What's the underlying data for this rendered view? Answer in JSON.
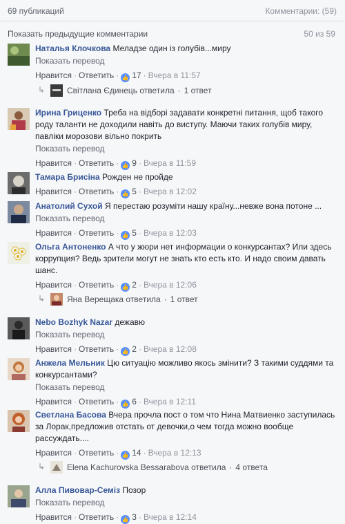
{
  "header": {
    "publications": "69 публикаций",
    "comments_total": "Комментарии: (59)"
  },
  "pager": {
    "previous_label": "Показать предыдущие комментарии",
    "count": "50 из 59"
  },
  "labels": {
    "translate": "Показать перевод",
    "like": "Нравится",
    "reply": "Ответить",
    "separator": "·"
  },
  "comments": [
    {
      "author": "Наталья Клочкова",
      "text": "Меладзе один із голубів...миру",
      "likes": "17",
      "time": "Вчера в 11:57",
      "reply": {
        "name": "Світлана Єдинець ответила",
        "count": "1 ответ"
      }
    },
    {
      "author": "Ирина Гриценко",
      "text": "Треба на відборі задавати конкретні питання, щоб такого роду таланти не доходили навіть до виступу. Маючи таких голубів миру, павліки морозови вільно покрить",
      "likes": "9",
      "time": "Вчера в 11:59"
    },
    {
      "author": "Тамара Брисіна",
      "text": "Рожден не пройде",
      "likes": "5",
      "time": "Вчера в 12:02"
    },
    {
      "author": "Анатолий Сухой",
      "text": "Я перестаю розуміти нашу країну...невже вона потоне ...",
      "likes": "5",
      "time": "Вчера в 12:03"
    },
    {
      "author": "Ольга Антоненко",
      "text": "А что у жюри нет информации о конкурсантах? Или здесь коррупция? Ведь зрители могут не знать кто есть кто. И надо своим давать шанс.",
      "likes": "2",
      "time": "Вчера в 12:06",
      "reply": {
        "name": "Яна Верещака ответила",
        "count": "1 ответ"
      }
    },
    {
      "author": "Nebo Bozhyk Nazar",
      "text": "дежавю",
      "likes": "2",
      "time": "Вчера в 12:08"
    },
    {
      "author": "Анжела Мельник",
      "text": "Цю ситуацію можливо якось змінити? З такими суддями та конкурсантами?",
      "likes": "6",
      "time": "Вчера в 12:11"
    },
    {
      "author": "Светлана Басова",
      "text": "Вчера прочла пост о том что Нина Матвиенко заступилась за Лорак,предложив отстать от девочки,о чем тогда можно вообще рассуждать....",
      "likes": "14",
      "time": "Вчера в 12:13",
      "reply": {
        "name": "Elena Kachurovska Bessarabova ответила",
        "count": "4 ответа"
      }
    },
    {
      "author": "Алла Пивовар-Семіз",
      "text": "Позор",
      "likes": "3",
      "time": "Вчера в 12:14"
    }
  ],
  "colors": {
    "link": "#385898",
    "muted": "#90949c",
    "like_blue": "#5890ff",
    "background": "#f6f7f9"
  }
}
